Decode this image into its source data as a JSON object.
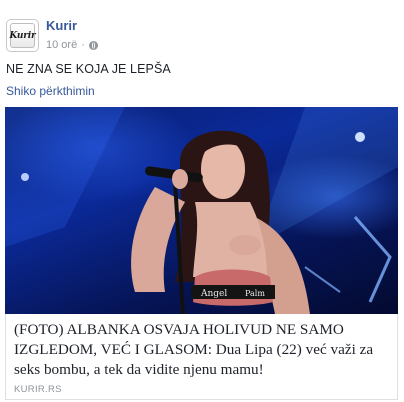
{
  "post": {
    "page_name": "Kurir",
    "avatar_logo_text": "Kurir",
    "time": "10 orë",
    "separator": "·",
    "text": "NE ZNA SE KOJA JE LEPŠA",
    "see_translation": "Shiko përkthimin"
  },
  "link_card": {
    "headline": "(FOTO) ALBANKA OSVAJA HOLIVUD NE SAMO IZGLEDOM, VEĆ I GLASOM: Dua Lipa (22) već važi za seks bombu, a tek da vidite njenu mamu!",
    "domain": "KURIR.RS",
    "image_top_text": "Angel",
    "image_strap_text": "Palm"
  },
  "colors": {
    "link_blue": "#365899",
    "meta_gray": "#90949c",
    "text_dark": "#1d2129",
    "stage_blue": "#0b2a9a"
  },
  "icons": {
    "privacy": "globe-icon"
  }
}
